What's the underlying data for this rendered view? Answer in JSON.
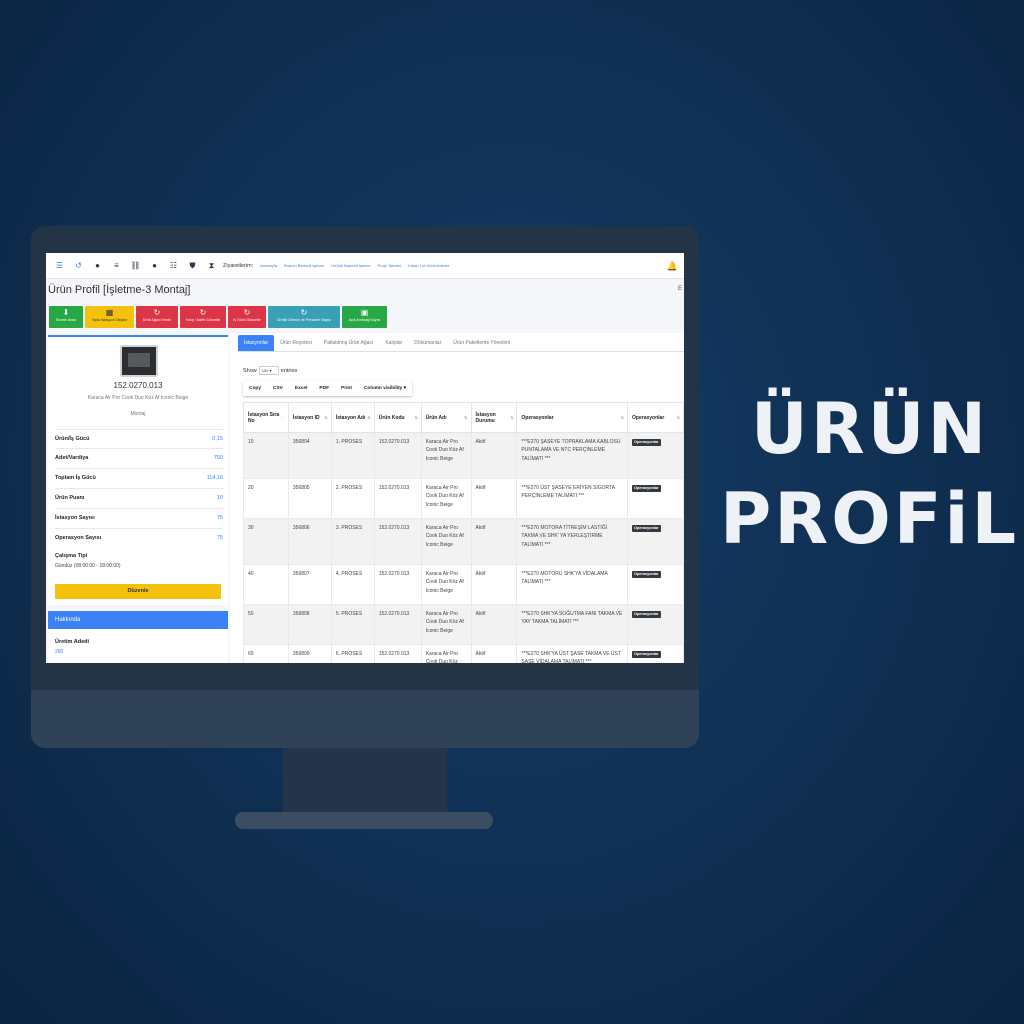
{
  "headline": {
    "line1": "ÜRÜN",
    "line2": "PROFiLi"
  },
  "topbar": {
    "visitors_label": "Ziyaretlerim:",
    "visitor_links": [
      "Anasayfa",
      "Branch Barkodl İşleme",
      "Ürünlü Barkodl İşleme",
      "Proje Takvimi",
      "Kalan Lot Görüntüleme"
    ]
  },
  "page": {
    "title": "Ürün Profil [İşletme-3 Montaj]",
    "edge": "E"
  },
  "actions": [
    {
      "label": "Excele Aktar",
      "color": "green",
      "icon": "download-icon",
      "glyph": "⬇"
    },
    {
      "label": "Toplu İstasyon Oluştur",
      "color": "yellow",
      "icon": "grid-icon",
      "glyph": "▦"
    },
    {
      "label": "Ürün Ağacı Verdir",
      "color": "red",
      "icon": "refresh-icon",
      "glyph": "↻"
    },
    {
      "label": "Kalıp / Adeti Güncelle",
      "color": "red",
      "icon": "refresh-icon",
      "glyph": "↻"
    },
    {
      "label": "İş Gücü Güncelle",
      "color": "red",
      "icon": "refresh-icon",
      "glyph": "↻"
    },
    {
      "label": "Üretilir Ürünün ve Personel Sayısı",
      "color": "teal",
      "icon": "refresh-icon",
      "glyph": "↻"
    },
    {
      "label": "Açık Ambalaj Sayısı",
      "color": "green",
      "icon": "box-icon",
      "glyph": "▣"
    }
  ],
  "product": {
    "code": "152.0270.013",
    "name": "Karaca Air Pro Cook Duo Köz Af Iconic Beige",
    "line": "Montaj",
    "stats": [
      {
        "label": "Ürün/İş Gücü",
        "value": "0,15"
      },
      {
        "label": "Adet/Vardiya",
        "value": "750"
      },
      {
        "label": "Toplam İş Gücü",
        "value": "114,16"
      },
      {
        "label": "Ürün Puanı",
        "value": "10"
      },
      {
        "label": "İstasyon Sayısı",
        "value": "75"
      },
      {
        "label": "Operasyon Sayısı",
        "value": "75"
      }
    ],
    "work_type_label": "Çalışma Tipi",
    "work_type_value": "Gündüz (08:00:00 - 18:00:00)",
    "edit_label": "Düzenle"
  },
  "about": {
    "header": "Hakkında",
    "label": "Üretim Adedi",
    "value": "260"
  },
  "tabs": [
    "İstasyonlar",
    "Ürün Reçetesi",
    "Patlatılmış Ürün Ağacı",
    "Kalıplar",
    "Dökümanlar",
    "Ürün Paketleme Yönetimi"
  ],
  "table": {
    "show_label": "Show",
    "show_value": "100",
    "entries_label": "entries",
    "exports": [
      "Copy",
      "CSV",
      "Excel",
      "PDF",
      "Print",
      "Column visibility ▾"
    ],
    "headers": [
      "İstasyon Sıra No",
      "İstasyon ID",
      "İstasyon Adı",
      "Ürün Kodu",
      "Ürün Adı",
      "İstasyon Durumu",
      "Operasyonlar",
      "Operasyonlar"
    ],
    "rows": [
      {
        "sira": "10",
        "id": "356804",
        "adi": "1. PROSES",
        "kod": "152.0270.013",
        "urun": "Karaca Air Pro Cook Duo Köz Af Iconic Beige",
        "durum": "Aktif",
        "op": "***E270 ŞASEYE TOPRAKLAMA KABLOSU PUNTALAMA VE NTC PERÇİNLEME TALİMATI ***",
        "badge": "Operasyonlar"
      },
      {
        "sira": "20",
        "id": "356805",
        "adi": "2. PROSES",
        "kod": "152.0270.013",
        "urun": "Karaca Air Pro Cook Duo Köz Af Iconic Beige",
        "durum": "Aktif",
        "op": "***E270 ÜST ŞASEYE ERİYEN SİGORTA PERÇİNLEME TALİMATI ***",
        "badge": "Operasyonlar"
      },
      {
        "sira": "30",
        "id": "356806",
        "adi": "3. PROSES",
        "kod": "152.0270.013",
        "urun": "Karaca Air Pro Cook Duo Köz Af Iconic Beige",
        "durum": "Aktif",
        "op": "***E270 MOTORA TİTREŞİM LASTİĞİ TAKMA VE SHK' YA YERLEŞTİRME TALİMATI ***",
        "badge": "Operasyonlar"
      },
      {
        "sira": "40",
        "id": "356807",
        "adi": "4. PROSES",
        "kod": "152.0270.013",
        "urun": "Karaca Air Pro Cook Duo Köz Af Iconic Beige",
        "durum": "Aktif",
        "op": "***E270 MOTORU SHK'YA VİDALAMA TALİMATI ***",
        "badge": "Operasyonlar"
      },
      {
        "sira": "50",
        "id": "356808",
        "adi": "5. PROSES",
        "kod": "152.0270.013",
        "urun": "Karaca Air Pro Cook Duo Köz Af Iconic Beige",
        "durum": "Aktif",
        "op": "***E270 SHK'YA SOĞUTMA FANI TAKMA VE YAY TAKMA TALİMATI ***",
        "badge": "Operasyonlar"
      },
      {
        "sira": "60",
        "id": "356809",
        "adi": "6. PROSES",
        "kod": "152.0270.013",
        "urun": "Karaca Air Pro Cook Duo Köz",
        "durum": "Aktif",
        "op": "***E270 SHK'YA ÜST ŞASE TAKMA VE ÜST ŞASE VİDALAMA TALİMATI ***",
        "badge": "Operasyonlar"
      }
    ]
  }
}
